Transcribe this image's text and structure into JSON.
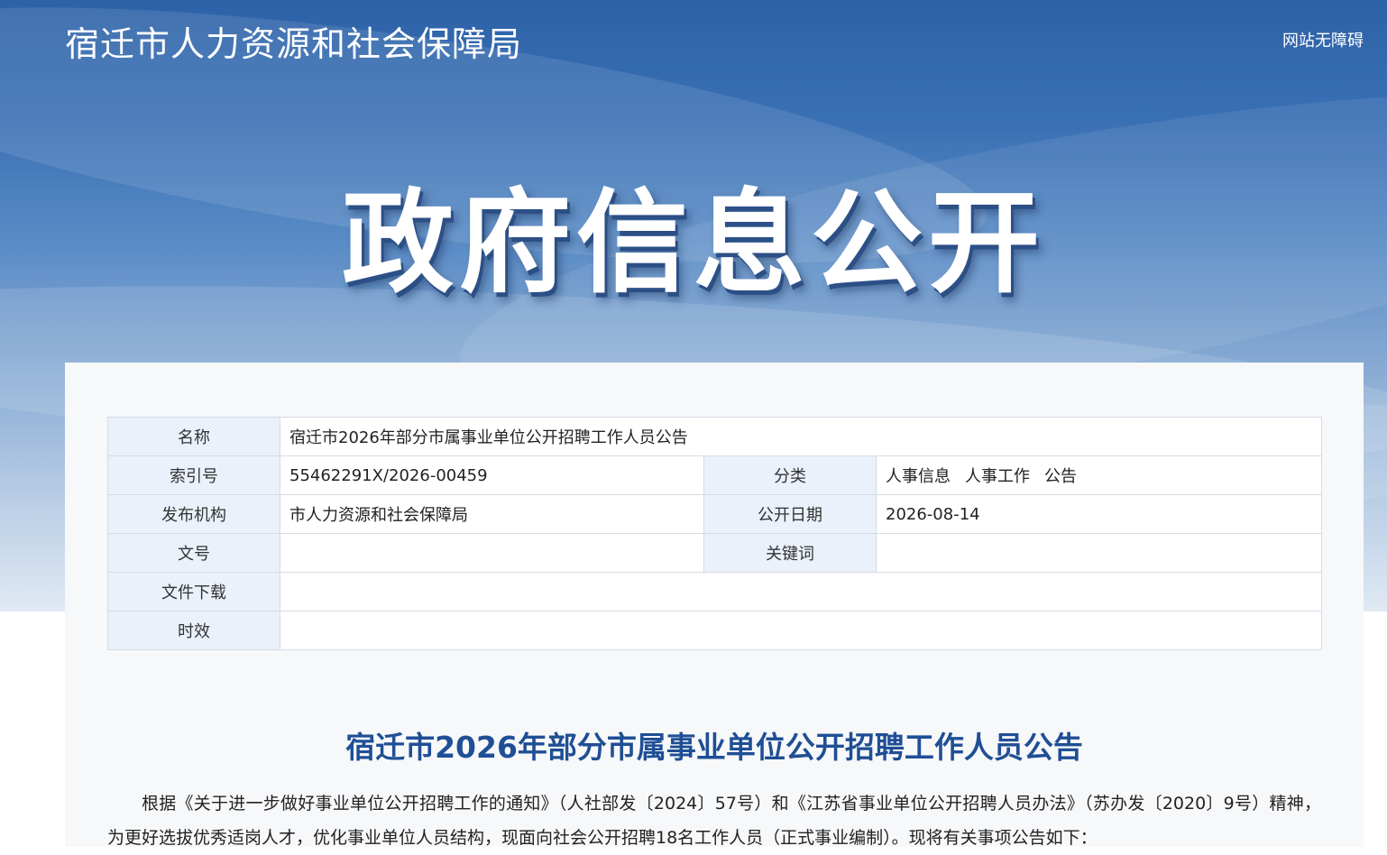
{
  "header": {
    "site_title": "宿迁市人力资源和社会保障局",
    "accessible_link": "网站无障碍",
    "banner_title": "政府信息公开"
  },
  "meta_table": {
    "name_label": "名称",
    "name_value": "宿迁市2026年部分市属事业单位公开招聘工作人员公告",
    "index_label": "索引号",
    "index_value": "55462291X/2026-00459",
    "category_label": "分类",
    "category_values": [
      "人事信息",
      "人事工作",
      "公告"
    ],
    "publisher_label": "发布机构",
    "publisher_value": "市人力资源和社会保障局",
    "date_label": "公开日期",
    "date_value": "2026-08-14",
    "docno_label": "文号",
    "docno_value": "",
    "keywords_label": "关键词",
    "keywords_value": "",
    "download_label": "文件下载",
    "download_value": "",
    "validity_label": "时效",
    "validity_value": ""
  },
  "article": {
    "title": "宿迁市2026年部分市属事业单位公开招聘工作人员公告",
    "paragraph1": "根据《关于进一步做好事业单位公开招聘工作的通知》（人社部发〔2024〕57号）和《江苏省事业单位公开招聘人员办法》（苏办发〔2020〕9号）精神，为更好选拔优秀适岗人才，优化事业单位人员结构，现面向社会公开招聘18名工作人员（正式事业编制）。现将有关事项公告如下："
  },
  "colors": {
    "title_blue": "#1f4f95",
    "label_bg": "#eaf1fb",
    "border": "#d5dbe5",
    "hero_top": "#2d62a8"
  }
}
